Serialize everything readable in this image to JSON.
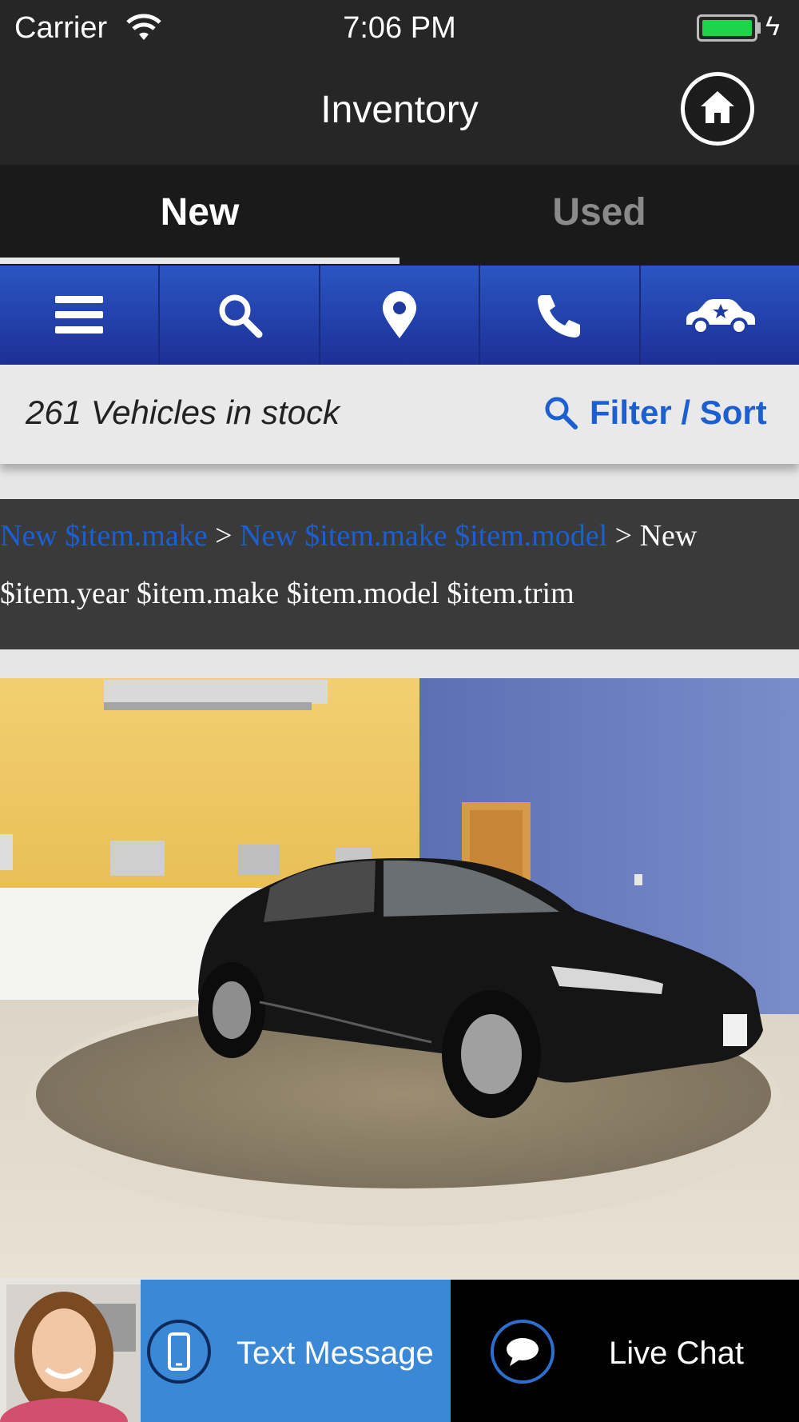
{
  "status": {
    "carrier": "Carrier",
    "time": "7:06 PM"
  },
  "nav": {
    "title": "Inventory",
    "home_icon": "home-icon"
  },
  "tabs": [
    {
      "label": "New",
      "active": true
    },
    {
      "label": "Used",
      "active": false
    }
  ],
  "toolbar": {
    "icons": [
      "menu-icon",
      "search-icon",
      "location-pin-icon",
      "phone-icon",
      "car-icon"
    ],
    "color": "#1d3ea8"
  },
  "stock": {
    "count_text": "261 Vehicles in stock",
    "filter_label": "Filter / Sort"
  },
  "breadcrumb": {
    "link1": "New $item.make",
    "sep1": " > ",
    "link2": "New $item.make $item.model",
    "sep2": " > ",
    "current_a": "New",
    "current_b": "$item.year $item.make $item.model $item.trim"
  },
  "bottom": {
    "text_label": "Text Message",
    "chat_label": "Live Chat"
  },
  "colors": {
    "accent": "#1c5fd0",
    "text_btn": "#3a88d6"
  }
}
